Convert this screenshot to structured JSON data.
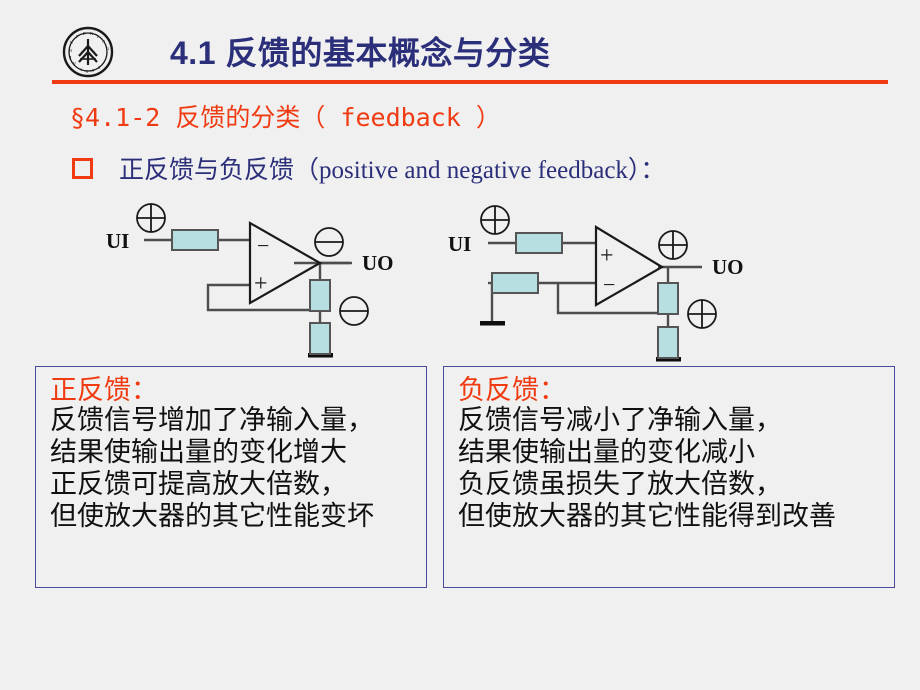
{
  "header": {
    "title": "4.1 反馈的基本概念与分类",
    "logo_icon": "peking-university-seal-icon",
    "rule_color": "#f03b12",
    "title_color": "#2b2f7a"
  },
  "section": {
    "heading": "§4.1-2 反馈的分类（ feedback ）",
    "heading_color": "#f03b12"
  },
  "bullet": {
    "marker_icon": "hollow-square-bullet-icon",
    "marker_color": "#f03b12",
    "text_cn_prefix": "正反馈与负反馈（",
    "text_en": "positive and negative feedback",
    "text_cn_suffix": "）：",
    "text_color": "#2b2f7a"
  },
  "diagrams": {
    "positive": {
      "name": "positive-feedback-circuit",
      "input_label": "UI",
      "output_label": "UO",
      "input_sign_icon": "plus-circle-icon",
      "output_sign_icon": "minus-circle-icon",
      "divider_sign_icon": "minus-circle-icon",
      "opamp_top_input": "−",
      "opamp_bottom_input": "+",
      "resistor_color": "#b7dfe2",
      "wire_color": "#4d4d4d"
    },
    "negative": {
      "name": "negative-feedback-circuit",
      "input_label": "UI",
      "output_label": "UO",
      "input_sign_icon": "plus-circle-icon",
      "output_sign_icon": "plus-circle-icon",
      "divider_sign_icon": "plus-circle-icon",
      "opamp_top_input": "+",
      "opamp_bottom_input": "−",
      "resistor_color": "#b7dfe2",
      "wire_color": "#4d4d4d"
    }
  },
  "notes": {
    "positive": {
      "title": "正反馈：",
      "lines": [
        "反馈信号增加了净输入量，",
        "结果使输出量的变化增大",
        "正反馈可提高放大倍数，",
        "但使放大器的其它性能变坏"
      ]
    },
    "negative": {
      "title": "负反馈：",
      "lines": [
        "反馈信号减小了净输入量，",
        "结果使输出量的变化减小",
        "负反馈虽损失了放大倍数，",
        "但使放大器的其它性能得到改善"
      ]
    }
  },
  "colors": {
    "background": "#f0f0f0",
    "accent_red": "#f03b12",
    "accent_navy": "#2b2f7a",
    "box_border": "#4a4a9e"
  }
}
